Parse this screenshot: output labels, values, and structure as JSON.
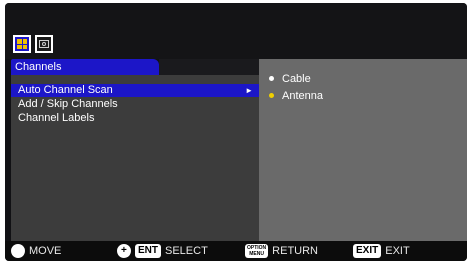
{
  "tab": {
    "label": "Channels"
  },
  "menu": {
    "items": [
      {
        "label": "Auto Channel Scan",
        "selected": true
      },
      {
        "label": "Add / Skip Channels",
        "selected": false
      },
      {
        "label": "Channel Labels",
        "selected": false
      }
    ]
  },
  "submenu": {
    "options": [
      {
        "label": "Cable",
        "bullet_color": "#ffffff"
      },
      {
        "label": "Antenna",
        "bullet_color": "#f0d000"
      }
    ]
  },
  "footer": {
    "move_label": "MOVE",
    "enter_key": "ENT",
    "select_label": "SELECT",
    "option_key_line1": "OPTION",
    "option_key_line2": "MENU",
    "return_label": "RETURN",
    "exit_key": "EXIT",
    "exit_label": "EXIT"
  },
  "icons": {
    "active_tab_icon": "grid-icon",
    "inactive_tab_icon": "camera-icon",
    "move_icon": "dpad-icon",
    "select_icon": "dpad-plus-icon"
  },
  "colors": {
    "highlight": "#1c16c8",
    "antenna_bullet": "#f0d000"
  }
}
